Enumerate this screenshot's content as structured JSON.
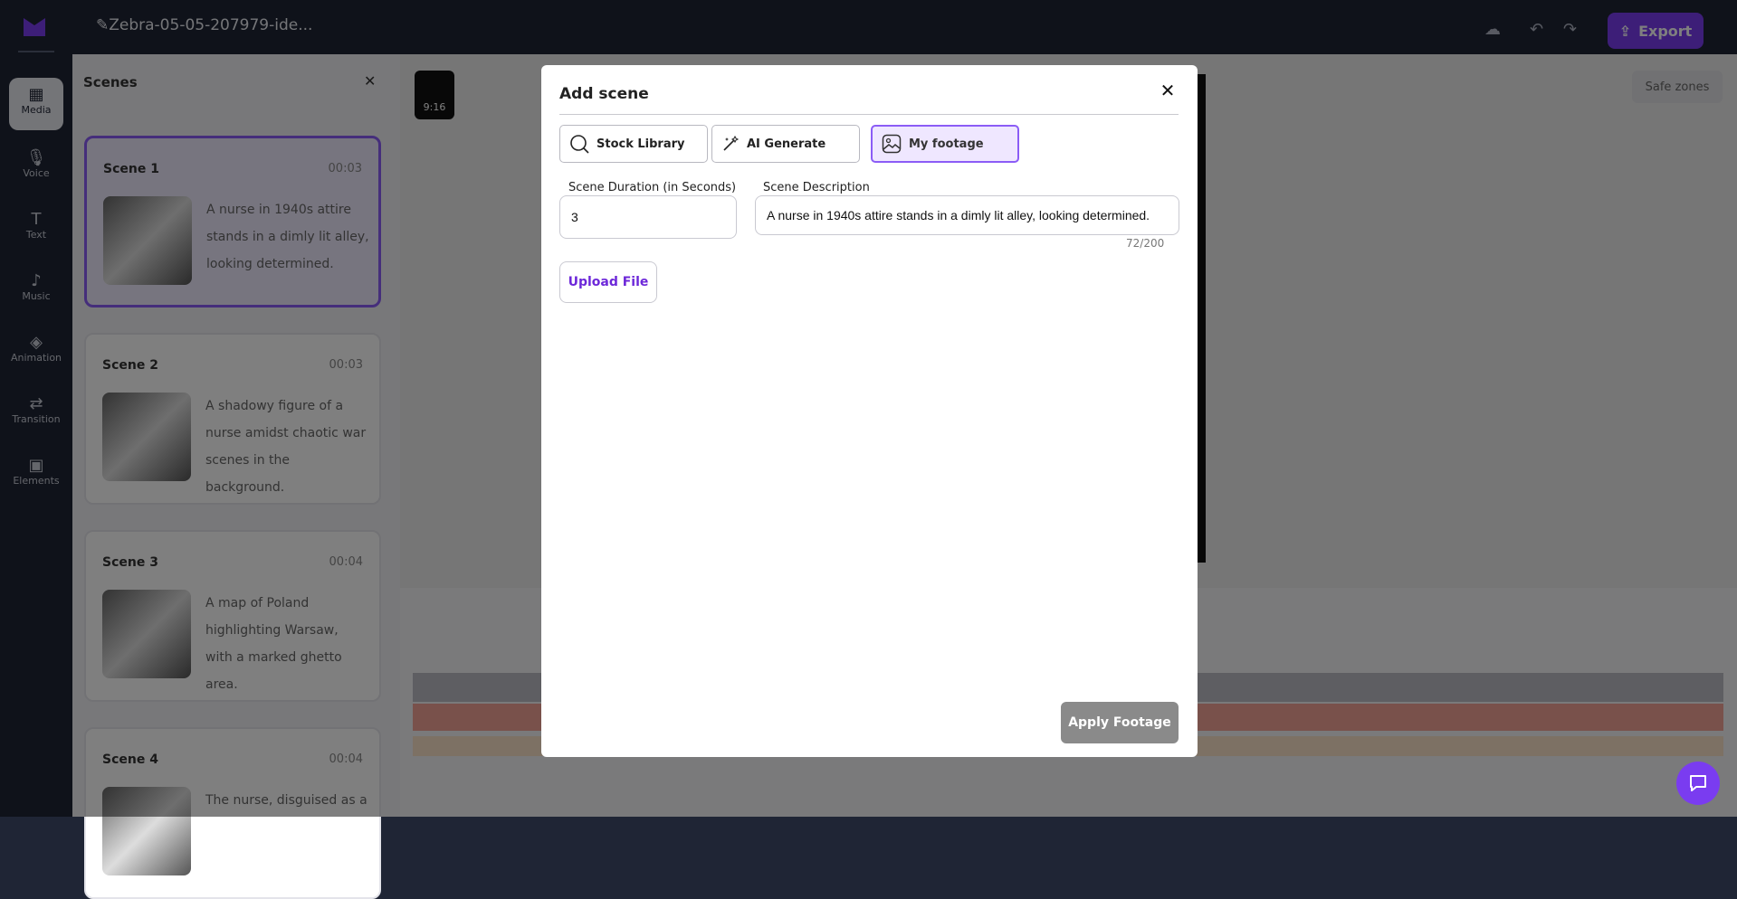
{
  "colors": {
    "accent": "#7a3cf0",
    "tab_active_border": "#8b5cf6",
    "tab_active_bg": "#efe7ff",
    "apply_button_bg": "#8a8a8a",
    "app_dark_bg": "#1f2535"
  },
  "app": {
    "file_title": "Zebra-05-05-207979-ide...",
    "export_label": "Export",
    "safe_zones_label": "Safe zones",
    "ratio_label": "9:16"
  },
  "rail": {
    "items": [
      {
        "label": "Media",
        "icon": "media-icon"
      },
      {
        "label": "Voice",
        "icon": "mic-icon"
      },
      {
        "label": "Text",
        "icon": "text-icon"
      },
      {
        "label": "Music",
        "icon": "music-icon"
      },
      {
        "label": "Animation",
        "icon": "animation-icon"
      },
      {
        "label": "Transition",
        "icon": "transition-icon"
      },
      {
        "label": "Elements",
        "icon": "elements-icon"
      }
    ]
  },
  "scenes_panel": {
    "title": "Scenes",
    "scenes": [
      {
        "name": "Scene 1",
        "time": "00:03",
        "description": "A nurse in 1940s attire stands in a dimly lit alley, looking determined."
      },
      {
        "name": "Scene 2",
        "time": "00:03",
        "description": "A shadowy figure of a nurse amidst chaotic war scenes in the background."
      },
      {
        "name": "Scene 3",
        "time": "00:04",
        "description": "A map of Poland highlighting Warsaw, with a marked ghetto area."
      },
      {
        "name": "Scene 4",
        "time": "00:04",
        "description": "The nurse, disguised as a"
      }
    ]
  },
  "modal": {
    "title": "Add scene",
    "tabs": [
      {
        "label": "Stock Library",
        "icon": "search-icon",
        "active": false
      },
      {
        "label": "AI Generate",
        "icon": "magic-wand-icon",
        "active": false
      },
      {
        "label": "My footage",
        "icon": "image-icon",
        "active": true
      }
    ],
    "duration": {
      "label": "Scene Duration (in Seconds)",
      "value": "3"
    },
    "description": {
      "label": "Scene Description",
      "value": "A nurse in 1940s attire stands in a dimly lit alley, looking determined.",
      "counter": "72/200"
    },
    "upload_label": "Upload File",
    "apply_label": "Apply Footage"
  }
}
